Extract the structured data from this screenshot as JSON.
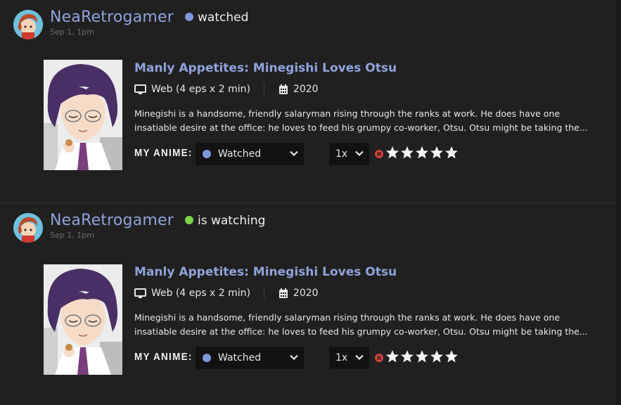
{
  "activities": [
    {
      "user": "NeaRetrogamer",
      "status_text": "watched",
      "status_color": "#7d97dc",
      "timestamp": "Sep 1, 1pm",
      "anime": {
        "title": "Manly Appetites: Minegishi Loves Otsu",
        "format": "Web (4 eps x 2 min)",
        "year": "2020",
        "description_lines": [
          "Minegishi is a handsome, friendly salaryman rising through the ranks at work. He does have one",
          "insatiable desire at the office: he loves to feed his grumpy co-worker, Otsu. Otsu might be taking the..."
        ]
      },
      "my_anime_label": "MY ANIME:",
      "list_status": "Watched",
      "list_status_color": "#7d97dc",
      "speed": "1x",
      "rating_stars": 0
    },
    {
      "user": "NeaRetrogamer",
      "status_text": "is watching",
      "status_color": "#7dd34a",
      "timestamp": "Sep 1, 1pm",
      "anime": {
        "title": "Manly Appetites: Minegishi Loves Otsu",
        "format": "Web (4 eps x 2 min)",
        "year": "2020",
        "description_lines": [
          "Minegishi is a handsome, friendly salaryman rising through the ranks at work. He does have one",
          "insatiable desire at the office: he loves to feed his grumpy co-worker, Otsu. Otsu might be taking the..."
        ]
      },
      "my_anime_label": "MY ANIME:",
      "list_status": "Watched",
      "list_status_color": "#7d97dc",
      "speed": "1x",
      "rating_stars": 0
    }
  ],
  "icons": {
    "format_icon": "monitor-icon",
    "year_icon": "calendar-icon",
    "clear_rating_icon": "clear-rating-icon",
    "dropdown_icon": "chevron-down-icon",
    "star_icon": "star-icon"
  }
}
